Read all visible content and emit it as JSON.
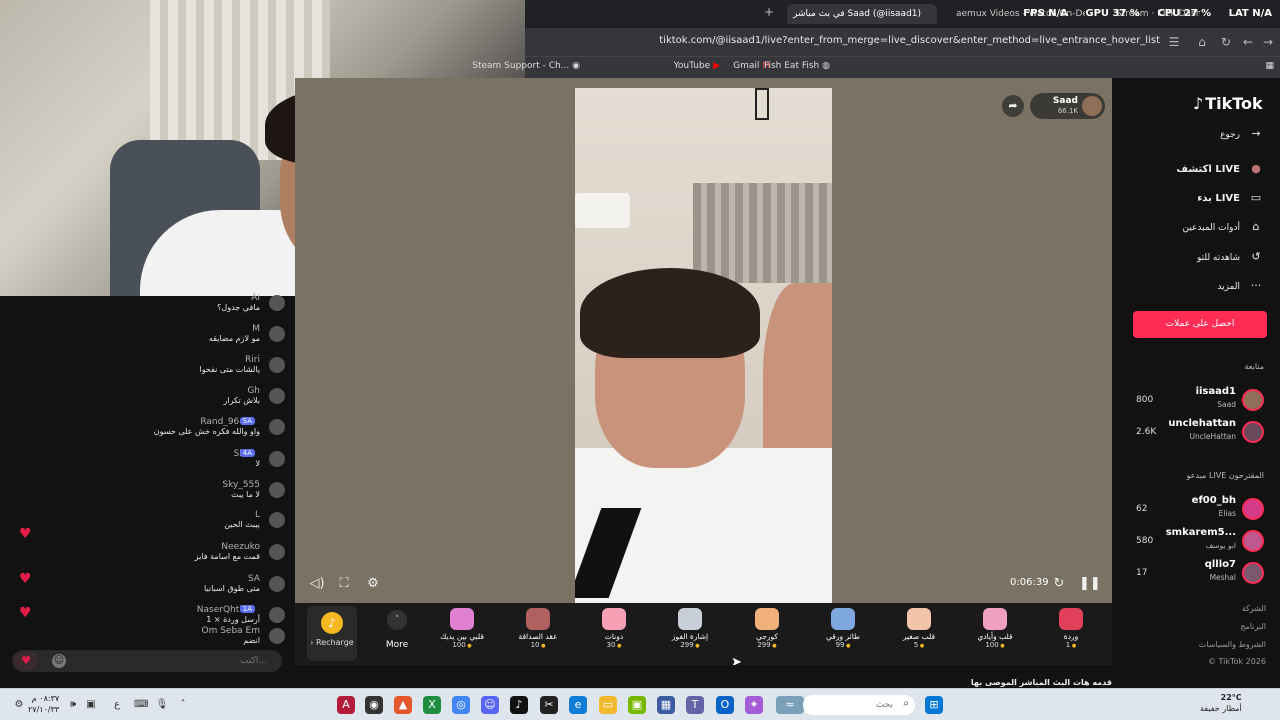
{
  "browser": {
    "tabs": [
      {
        "label": "في بث مباشر Saad (@iisaad1)",
        "active": true
      },
      {
        "label": "aemux Videos - Watch On-Dem"
      },
      {
        "label": "Stream · Kick Dashboard"
      }
    ],
    "overlay_stats": {
      "fps": "FPS N/A",
      "gpu": "GPU 37 %",
      "cpu": "CPU 27 %",
      "lat": "LAT N/A"
    },
    "url": "tiktok.com/@iisaad1/live?enter_from_merge=live_discover&enter_method=live_entrance_hover_list",
    "bookmarks": [
      "Steam Support - Ch...",
      "YouTube",
      "Gmail",
      "Fish Eat Fish"
    ]
  },
  "chat": {
    "messages": [
      {
        "name": "AI",
        "text": "مافي جدول؟"
      },
      {
        "name": "M",
        "text": "مو لازم مضايقه"
      },
      {
        "name": "Riri",
        "text": "يالشات متى نفحوا"
      },
      {
        "name": "Gh",
        "text": "بلاش تكرار"
      },
      {
        "name": "Rand_966",
        "badge": "SA",
        "text": "واو والله فكره خش على حسون"
      },
      {
        "name": "Sh",
        "badge": "4A",
        "text": "لا"
      },
      {
        "name": "Sky_555",
        "text": "لا ما يبث"
      },
      {
        "name": "L",
        "text": "بيبث الحين"
      },
      {
        "name": "Neezuko",
        "text": "قمت مع اسامة فايز"
      },
      {
        "name": "SA",
        "text": "متى طوق اسبانيا"
      },
      {
        "name": "NaserQht7",
        "badge": "1A",
        "text": "أرسل وردة × 1"
      },
      {
        "name": "Om Seba Em",
        "text": "انضم"
      }
    ],
    "input_placeholder": "اكتب..."
  },
  "player": {
    "host_name": "Saad",
    "host_likes": "66.1K",
    "timer": "0:06:39"
  },
  "gifts": {
    "recharge_label": "Recharge",
    "more_label": "More",
    "items": [
      {
        "name": "وردة",
        "price": "1",
        "color": "#e0405a"
      },
      {
        "name": "قلب وأيادي",
        "price": "100",
        "color": "#f0a0c0"
      },
      {
        "name": "قلب صغير",
        "price": "5",
        "color": "#f2c4a8"
      },
      {
        "name": "طائر ورقي",
        "price": "99",
        "color": "#7fa8e0"
      },
      {
        "name": "كورجي",
        "price": "299",
        "color": "#f0b07a"
      },
      {
        "name": "إشارة الفوز",
        "price": "299",
        "color": "#c9cfd8"
      },
      {
        "name": "دونات",
        "price": "30",
        "color": "#f5a0b5"
      },
      {
        "name": "عقد الصداقة",
        "price": "10",
        "color": "#b06060"
      },
      {
        "name": "قلبي بين يديك",
        "price": "100",
        "color": "#e080d0"
      }
    ]
  },
  "sidebar": {
    "logo": "TikTok",
    "back_label": "رجوع",
    "nav": [
      {
        "label": "اكتشف LIVE",
        "icon": "discover-live-icon",
        "glyph": "●"
      },
      {
        "label": "بدء LIVE",
        "icon": "camera-icon",
        "glyph": "▭"
      },
      {
        "label": "أدوات المبدعين",
        "icon": "creator-tools-icon",
        "glyph": "⌂"
      },
      {
        "label": "شاهدته للتو",
        "icon": "history-icon",
        "glyph": "↺"
      },
      {
        "label": "المزيد",
        "icon": "more-icon",
        "glyph": "···"
      }
    ],
    "get_coins_label": "احصل على عملات",
    "following_header": "متابعة",
    "following": [
      {
        "username": "iisaad1",
        "display": "Saad",
        "count": "800",
        "color": "#8f6f58"
      },
      {
        "username": "unclehattan",
        "display": "UncleHattan",
        "count": "2.6K",
        "color": "#6a4a5a"
      }
    ],
    "suggested_header": "مبدعو LIVE المقترحون",
    "suggested": [
      {
        "username": "ef00_bh",
        "display": "Elias",
        "count": "62",
        "color": "#d63a8a"
      },
      {
        "username": "smkarem5...",
        "display": "ابو يوسف",
        "count": "580",
        "color": "#c05890"
      },
      {
        "username": "qlllo7",
        "display": "Meshal",
        "count": "17",
        "color": "#7a5870"
      }
    ],
    "footer": [
      "الشركة",
      "البرنامج",
      "الشروط والسياسات",
      "© TikTok 2026"
    ]
  },
  "bottom_text": "قدمه هات البث المباشر   الموصى بها",
  "taskbar": {
    "time": "٠٨:٣٧ م",
    "date": "٢٧/١٠/٣٣",
    "lang": "ع",
    "search_placeholder": "بحث",
    "weather_temp": "22°C",
    "weather_text": "أمطار خفيفة"
  }
}
